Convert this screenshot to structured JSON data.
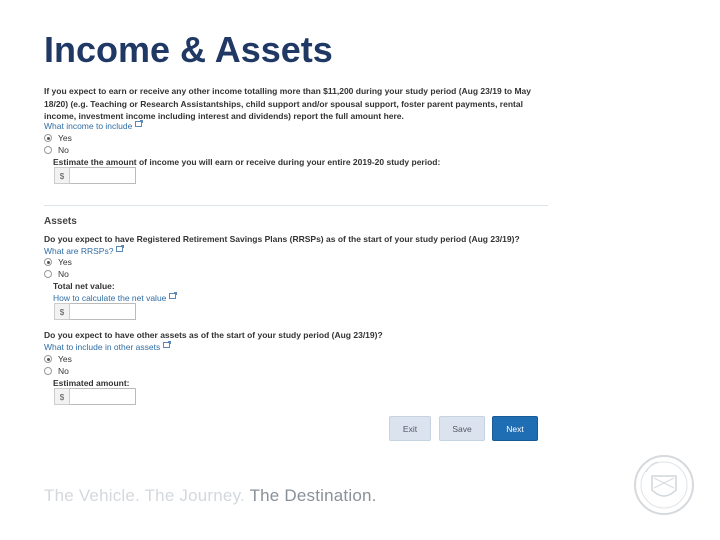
{
  "slide": {
    "title": "Income & Assets"
  },
  "income": {
    "question": "If you expect to earn or receive any other income totalling more than $11,200 during your study period (Aug 23/19 to May 18/20) (e.g. Teaching or Research Assistantships, child support and/or spousal support, foster parent payments, rental income, investment income including interest and dividends) report the full amount here.",
    "help_link": "What income to include",
    "options": [
      "Yes",
      "No"
    ],
    "selected": "Yes",
    "estimate_label": "Estimate the amount of income you will earn or receive during your entire 2019-20 study period:",
    "currency_prefix": "$",
    "amount": ""
  },
  "assets": {
    "heading": "Assets",
    "rrsp_question": "Do you expect to have Registered Retirement Savings Plans (RRSPs) as of the start of your study period (Aug 23/19)?",
    "rrsp_link": "What are RRSPs?",
    "rrsp_options": [
      "Yes",
      "No"
    ],
    "rrsp_selected": "Yes",
    "net_value_label": "Total net value:",
    "net_value_link": "How to calculate the net value",
    "currency_prefix": "$",
    "net_value": "",
    "other_question": "Do you expect to have other assets as of the start of your study period (Aug 23/19)?",
    "other_link": "What to include in other assets",
    "other_options": [
      "Yes",
      "No"
    ],
    "other_selected": "Yes",
    "estimated_label": "Estimated amount:",
    "estimated_amount": ""
  },
  "buttons": {
    "exit": "Exit",
    "save": "Save",
    "next": "Next"
  },
  "tagline": {
    "part1": "The Vehicle. The Journey. ",
    "part2": "The Destination."
  },
  "colors": {
    "title": "#1f3864",
    "link": "#2e6da4",
    "primary_button": "#1f6db2"
  },
  "icons": {
    "external_link": "external-link-icon",
    "seal": "university-seal-logo"
  }
}
